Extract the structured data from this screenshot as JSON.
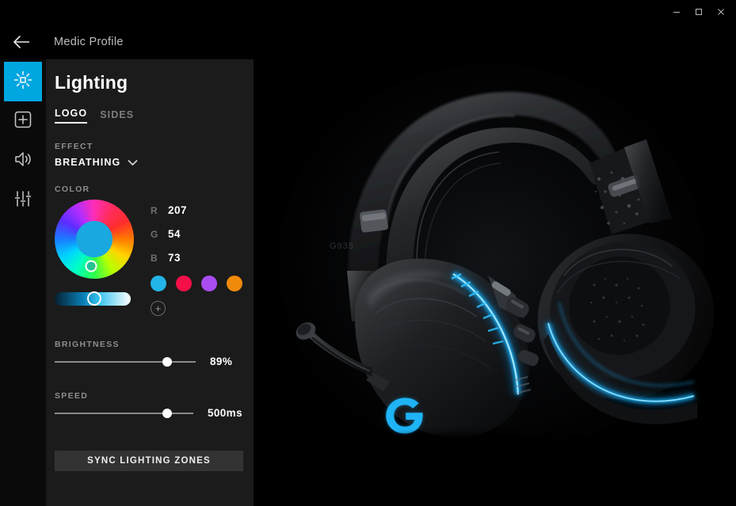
{
  "window": {
    "minimize_label": "—",
    "maximize_label": "□",
    "close_label": "×"
  },
  "header": {
    "back_icon": "back-arrow-icon",
    "profile_name": "Medic Profile"
  },
  "sidebar": {
    "items": [
      {
        "icon": "brightness-icon",
        "name": "lighting",
        "active": true
      },
      {
        "icon": "plus-square-icon",
        "name": "macros",
        "active": false
      },
      {
        "icon": "speaker-icon",
        "name": "audio",
        "active": false
      },
      {
        "icon": "equalizer-icon",
        "name": "equalizer",
        "active": false
      }
    ]
  },
  "panel": {
    "title": "Lighting",
    "tabs": [
      {
        "label": "LOGO",
        "active": true
      },
      {
        "label": "SIDES",
        "active": false
      }
    ],
    "effect": {
      "label": "EFFECT",
      "value": "BREATHING",
      "chevron": "chevron-down-icon"
    },
    "color": {
      "label": "COLOR",
      "selected_hex": "#19a8e0",
      "rgb": [
        {
          "key": "R",
          "value": "207"
        },
        {
          "key": "G",
          "value": "54"
        },
        {
          "key": "B",
          "value": "73"
        }
      ],
      "swatches": [
        {
          "hex": "#23b5e8",
          "name": "swatch-cyan"
        },
        {
          "hex": "#f5104a",
          "name": "swatch-red"
        },
        {
          "hex": "#a94cf0",
          "name": "swatch-purple"
        },
        {
          "hex": "#f08a0a",
          "name": "swatch-orange"
        }
      ],
      "add_label": "+",
      "saturation_percent": 52
    },
    "brightness": {
      "label": "BRIGHTNESS",
      "value": "89%",
      "percent": 80
    },
    "speed": {
      "label": "SPEED",
      "value": "500ms",
      "percent": 80
    },
    "sync_button": "SYNC LIGHTING ZONES"
  },
  "stage": {
    "product_name": "logitech-g935-headset",
    "led_color": "#13a9ef",
    "logo_mark": "logitech-g-logo"
  }
}
